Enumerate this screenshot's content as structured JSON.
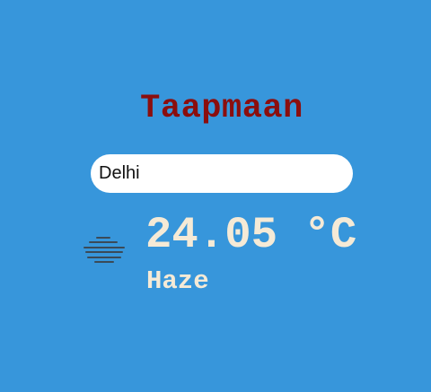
{
  "app": {
    "title": "Taapmaan"
  },
  "search": {
    "value": "Delhi",
    "placeholder": ""
  },
  "weather": {
    "temperature": "24.05 °C",
    "condition": "Haze",
    "icon": "haze-icon"
  },
  "colors": {
    "background": "#3796db",
    "title": "#8b0e0e",
    "text": "#f5ead6",
    "icon": "#3b4a57"
  }
}
